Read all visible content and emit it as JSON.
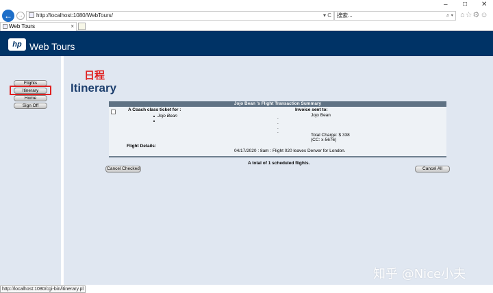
{
  "browser": {
    "window_controls": [
      "–",
      "□",
      "✕"
    ],
    "url": "http://localhost:1080/WebTours/",
    "url_controls": "▾ C",
    "search_placeholder": "搜索...",
    "search_controls": "⌕ ▾",
    "tab_title": "Web Tours",
    "tab_close": "×",
    "toolbar_icons": "⌂☆⚙☺"
  },
  "site": {
    "logo": "hp",
    "title": "Web Tours"
  },
  "nav": {
    "items": [
      {
        "label": "Flights"
      },
      {
        "label": "Itinerary"
      },
      {
        "label": "Home"
      },
      {
        "label": "Sign Off"
      }
    ]
  },
  "page": {
    "cn_title": "日程",
    "title": "Itinerary"
  },
  "summary": {
    "header": "Jojo Bean 's Flight Transaction Summary",
    "ticket_heading": "A Coach class ticket for :",
    "passenger": "Jojo Bean",
    "invoice_heading": "Invoice sent to:",
    "invoice_name": "Jojo Bean",
    "dots": [
      ".",
      ".",
      ".",
      "."
    ],
    "total_charge": "Total Charge: $ 338",
    "cc": "(CC: x-5676)",
    "flight_details_label": "Flight Details:",
    "flight_details": "04/17/2020 : 8am : Flight 020 leaves Denver for London."
  },
  "footer": {
    "total_flights": "A total of 1 scheduled flights.",
    "cancel_checked": "Cancel Checked",
    "cancel_all": "Cancel All"
  },
  "watermark": "知乎 @Nice小夫",
  "status_url": "http://localhost:1080/cgi-bin/itinerary.pl"
}
